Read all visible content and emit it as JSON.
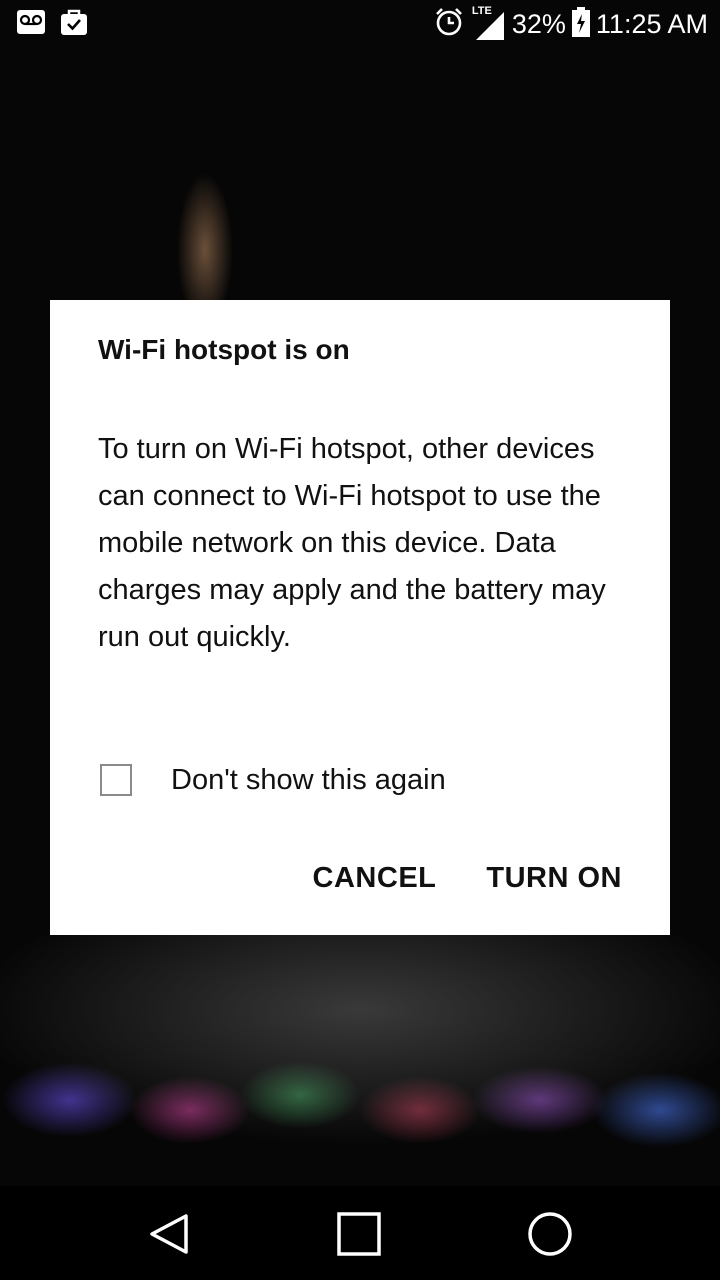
{
  "status_bar": {
    "left_icons": [
      "voicemail-icon",
      "task-done-icon"
    ],
    "network_label": "LTE",
    "battery_percent": "32%",
    "time": "11:25 AM",
    "right_icons": [
      "alarm-icon",
      "signal-icon",
      "battery-charging-icon"
    ]
  },
  "dialog": {
    "title": "Wi-Fi hotspot is on",
    "message": "To turn on Wi-Fi hotspot, other devices can connect to Wi-Fi hotspot to use the mobile network on this device. Data charges may apply and the battery may run out quickly.",
    "checkbox": {
      "label": "Don't show this again",
      "checked": false
    },
    "buttons": {
      "cancel": "CANCEL",
      "confirm": "TURN ON"
    }
  },
  "nav_bar": {
    "buttons": [
      "back-icon",
      "home-icon",
      "recents-icon"
    ]
  },
  "colors": {
    "dialog_background": "#ffffff",
    "text": "#111111",
    "checkbox_border": "#8a8a8a",
    "nav_background": "#000000"
  }
}
